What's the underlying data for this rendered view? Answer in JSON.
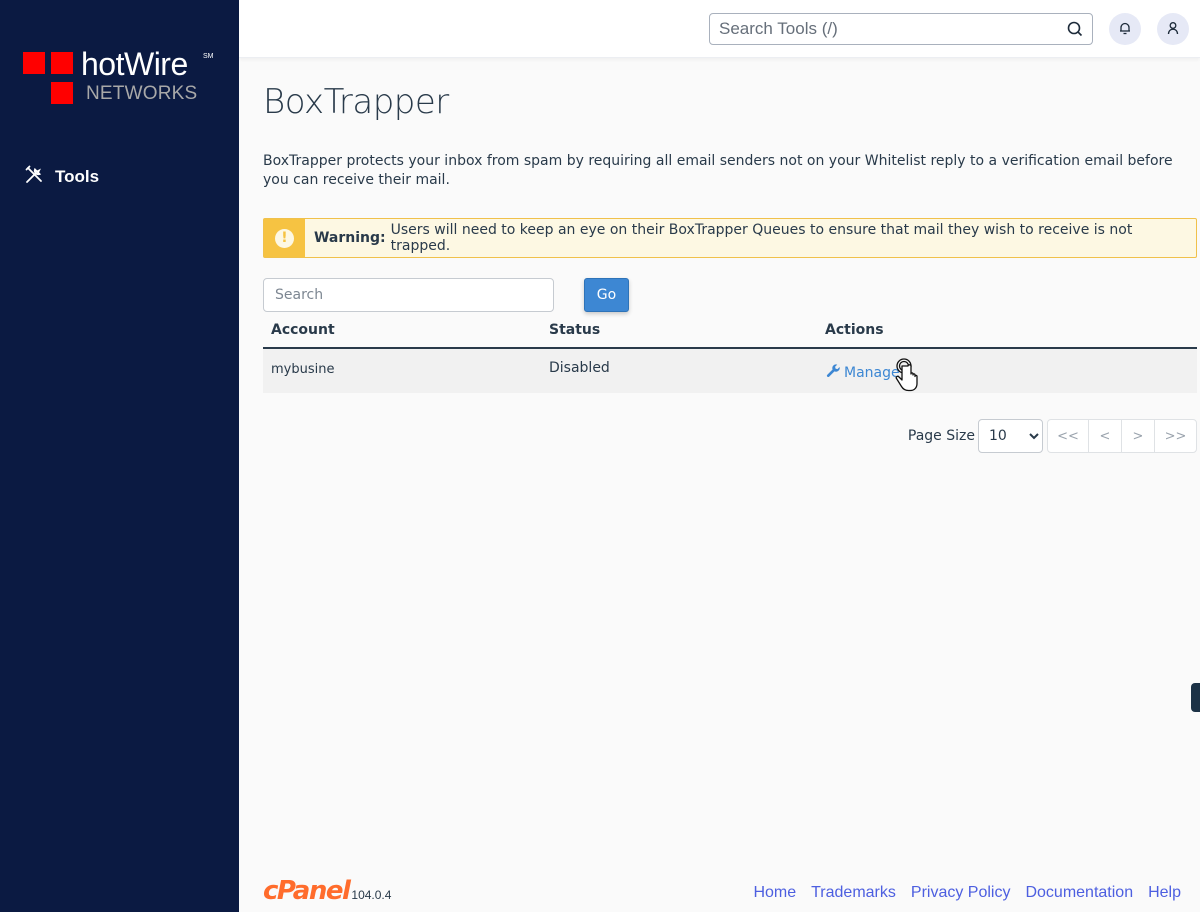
{
  "sidebar": {
    "logo": {
      "brand": "hotWire",
      "service_mark": "SM",
      "subtitle": "NETWORKS"
    },
    "items": [
      {
        "label": "Tools",
        "icon": "tools-icon"
      }
    ]
  },
  "topbar": {
    "search_placeholder": "Search Tools (/)",
    "search_icon": "search-icon",
    "notifications_icon": "bell-icon",
    "user_icon": "user-icon"
  },
  "main": {
    "title": "BoxTrapper",
    "description": "BoxTrapper protects your inbox from spam by requiring all email senders not on your Whitelist reply to a verification email before you can receive their mail.",
    "warning": {
      "icon": "exclamation-icon",
      "label": "Warning:",
      "text": "Users will need to keep an eye on their BoxTrapper Queues to ensure that mail they wish to receive is not trapped."
    },
    "search": {
      "placeholder": "Search",
      "value": "",
      "go_label": "Go"
    },
    "table": {
      "columns": [
        "Account",
        "Status",
        "Actions"
      ],
      "rows": [
        {
          "account": "mybusine",
          "status": "Disabled",
          "action": "Manage"
        }
      ]
    },
    "pagination": {
      "page_size_label": "Page Size",
      "page_size_value": "10",
      "first": "<<",
      "prev": "<",
      "next": ">",
      "last": ">>"
    }
  },
  "footer": {
    "brand": "cPanel",
    "version": "104.0.4",
    "links": [
      "Home",
      "Trademarks",
      "Privacy Policy",
      "Documentation",
      "Help"
    ]
  },
  "colors": {
    "sidebar_bg": "#0b1a42",
    "accent_blue": "#3d87d3",
    "warning_yellow": "#f6c342",
    "cpanel_orange": "#ff6c2c",
    "footer_link": "#4d5fe0"
  }
}
